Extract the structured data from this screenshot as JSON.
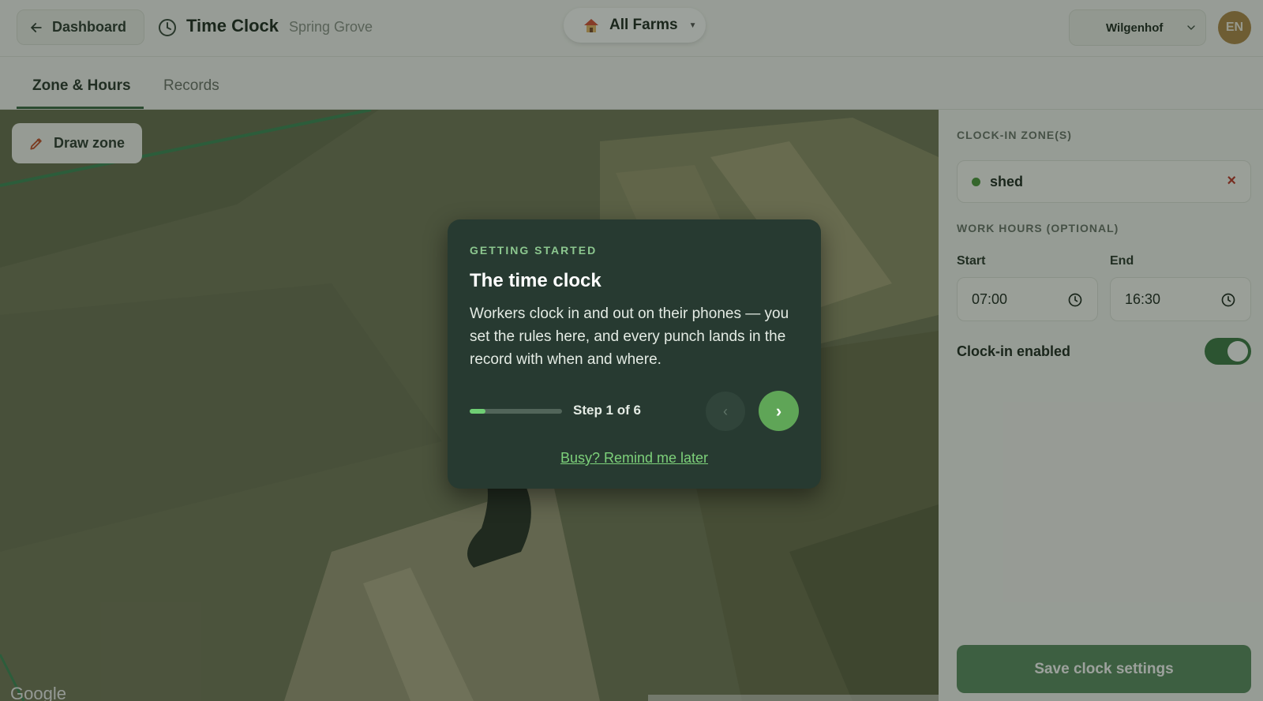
{
  "header": {
    "back_label": "Dashboard",
    "title": "Time Clock",
    "subtitle": "Spring Grove",
    "farms_pill": "All Farms",
    "farm_select": "Wilgenhof",
    "avatar_initials": "EN"
  },
  "tabs": [
    {
      "label": "Zone & Hours",
      "active": true
    },
    {
      "label": "Records",
      "active": false
    }
  ],
  "map": {
    "draw_zone_label": "Draw zone",
    "provider_logo": "Google"
  },
  "panel": {
    "zones_heading": "CLOCK-IN ZONE(S)",
    "zones": [
      {
        "name": "shed",
        "color": "#4f9a3f"
      }
    ],
    "hours_heading": "WORK HOURS (OPTIONAL)",
    "start_label": "Start",
    "start_value": "07:00",
    "end_label": "End",
    "end_value": "16:30",
    "toggle_label": "Clock-in enabled",
    "toggle_on": true,
    "save_label": "Save clock settings"
  },
  "dialog": {
    "eyebrow": "GETTING STARTED",
    "title": "The time clock",
    "body": "Workers clock in and out on their phones — you set the rules here, and every punch lands in the record with when and where.",
    "step_text": "Step 1 of 6",
    "progress_fraction": 0.1667,
    "prev_glyph": "‹",
    "next_glyph": "›",
    "remind_label": "Busy? Remind me later"
  },
  "colors": {
    "accent": "#3e7a47",
    "dialog_bg": "#273a31",
    "highlight_green": "#7dd17a"
  }
}
